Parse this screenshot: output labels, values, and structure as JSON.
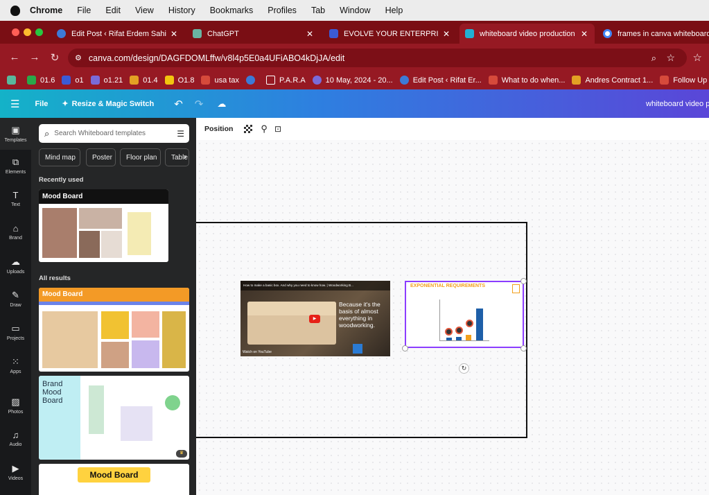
{
  "menubar": {
    "items": [
      "Chrome",
      "File",
      "Edit",
      "View",
      "History",
      "Bookmarks",
      "Profiles",
      "Tab",
      "Window",
      "Help"
    ]
  },
  "tabs": [
    {
      "title": "Edit Post ‹ Rifat Erdem Sahin",
      "icon": "wordpress-icon",
      "color": "#3d7ad6",
      "active": false
    },
    {
      "title": "ChatGPT",
      "icon": "chatgpt-icon",
      "color": "#6ab3a2",
      "active": false
    },
    {
      "title": "EVOLVE YOUR ENTERPRISE (",
      "icon": "shield-icon",
      "color": "#3b5bd6",
      "active": false
    },
    {
      "title": "whiteboard video production (",
      "icon": "canva-icon",
      "color": "#22b0d3",
      "active": true
    },
    {
      "title": "frames in canva whiteboard -",
      "icon": "google-icon",
      "color": "#ffffff",
      "active": false
    }
  ],
  "address": {
    "url": "canva.com/design/DAGFDOMLffw/v8l4p5E0a4UFiABO4kDjJA/edit"
  },
  "bookmarks": [
    {
      "label": "",
      "color": "#5ab89c"
    },
    {
      "label": "01.6",
      "color": "#2aa84a"
    },
    {
      "label": "o1",
      "color": "#3b5bd6"
    },
    {
      "label": "o1.21",
      "color": "#7a6bd8"
    },
    {
      "label": "01.4",
      "color": "#e3a024"
    },
    {
      "label": "O1.8",
      "color": "#f2c40f"
    },
    {
      "label": "usa tax",
      "color": "#d64a3b"
    },
    {
      "label": "",
      "color": "#3d7ad6"
    },
    {
      "label": "P.A.R.A",
      "color": "#961923"
    },
    {
      "label": "10 May, 2024 - 20...",
      "color": "#7a6bd8"
    },
    {
      "label": "Edit Post ‹ Rifat Er...",
      "color": "#3d7ad6"
    },
    {
      "label": "What to do when...",
      "color": "#d64a3b"
    },
    {
      "label": "Andres Contract 1...",
      "color": "#e3a024"
    },
    {
      "label": "Follow Up Fr",
      "color": "#d64a3b"
    }
  ],
  "canva_header": {
    "file_label": "File",
    "resize_label": "Resize & Magic Switch",
    "doc_title": "whiteboard video pr"
  },
  "rail": [
    {
      "label": "Templates",
      "icon": "templates-icon"
    },
    {
      "label": "Elements",
      "icon": "elements-icon"
    },
    {
      "label": "Text",
      "icon": "text-icon"
    },
    {
      "label": "Brand",
      "icon": "brand-icon"
    },
    {
      "label": "Uploads",
      "icon": "uploads-icon"
    },
    {
      "label": "Draw",
      "icon": "draw-icon"
    },
    {
      "label": "Projects",
      "icon": "projects-icon"
    },
    {
      "label": "Apps",
      "icon": "apps-icon"
    },
    {
      "label": "Photos",
      "icon": "photos-icon"
    },
    {
      "label": "Audio",
      "icon": "audio-icon"
    },
    {
      "label": "Videos",
      "icon": "videos-icon"
    }
  ],
  "panel": {
    "search_placeholder": "Search Whiteboard templates",
    "chips": [
      "Mind map",
      "Poster",
      "Floor plan",
      "Table"
    ],
    "recently_used": "Recently used",
    "all_results": "All results",
    "thumbs": [
      {
        "title": "Mood Board"
      },
      {
        "title": "Mood Board"
      },
      {
        "title": "Brand Mood Board"
      },
      {
        "title": "Mood Board"
      }
    ]
  },
  "toolbar": {
    "position_label": "Position"
  },
  "canvas": {
    "video": {
      "title": "How to make a basic box. And why you need to know how. | Woodworking B...",
      "overlay": "Because it's the basis of almost everything in woodworking.",
      "watch_on": "Watch on  YouTube"
    },
    "chart": {
      "title": "EXPONENTIAL REQUIREMENTS"
    }
  }
}
